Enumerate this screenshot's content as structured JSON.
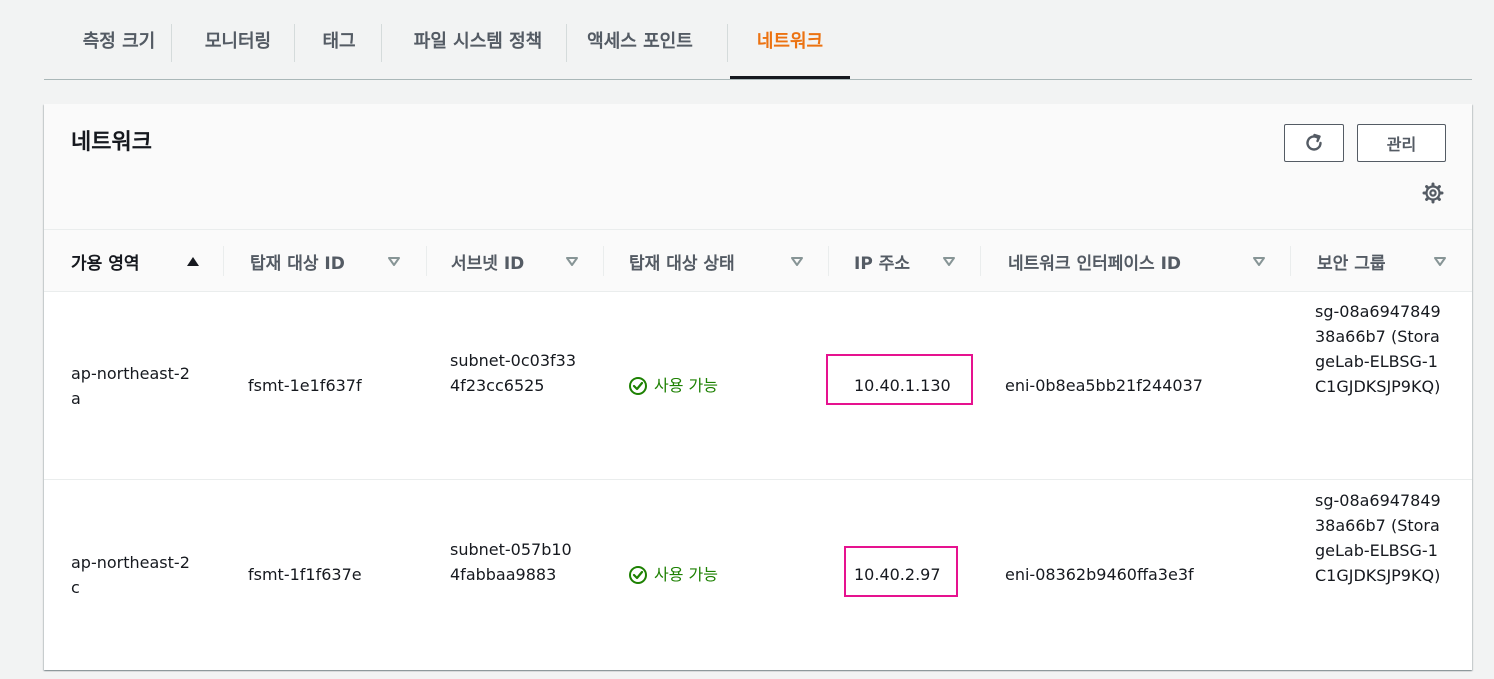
{
  "tabs": [
    "측정 크기",
    "모니터링",
    "태그",
    "파일 시스템 정책",
    "액세스 포인트",
    "네트워크"
  ],
  "active_tab": "네트워크",
  "panel": {
    "title": "네트워크",
    "manage_label": "관리"
  },
  "columns": [
    "가용 영역",
    "탑재 대상 ID",
    "서브넷 ID",
    "탑재 대상 상태",
    "IP 주소",
    "네트워크 인터페이스 ID",
    "보안 그룹"
  ],
  "rows": [
    {
      "az": "ap-northeast-2a",
      "mount_target_id": "fsmt-1e1f637f",
      "subnet_id": "subnet-0c03f334f23cc6525",
      "status": "사용 가능",
      "ip": "10.40.1.130",
      "eni": "eni-0b8ea5bb21f244037",
      "security_group": "sg-08a694784938a66b7 (StorageLab-ELBSG-1C1GJDKSJP9KQ)"
    },
    {
      "az": "ap-northeast-2c",
      "mount_target_id": "fsmt-1f1f637e",
      "subnet_id": "subnet-057b104fabbaa9883",
      "status": "사용 가능",
      "ip": "10.40.2.97",
      "eni": "eni-08362b9460ffa3e3f",
      "security_group": "sg-08a694784938a66b7 (StorageLab-ELBSG-1C1GJDKSJP9KQ)"
    }
  ],
  "colors": {
    "active_tab": "#ec7211",
    "status_ok": "#1d8102",
    "highlight": "#e6128f"
  },
  "icons": [
    "refresh-icon",
    "gear-icon",
    "sort-asc-icon",
    "sort-desc-icon",
    "status-ok-icon"
  ]
}
